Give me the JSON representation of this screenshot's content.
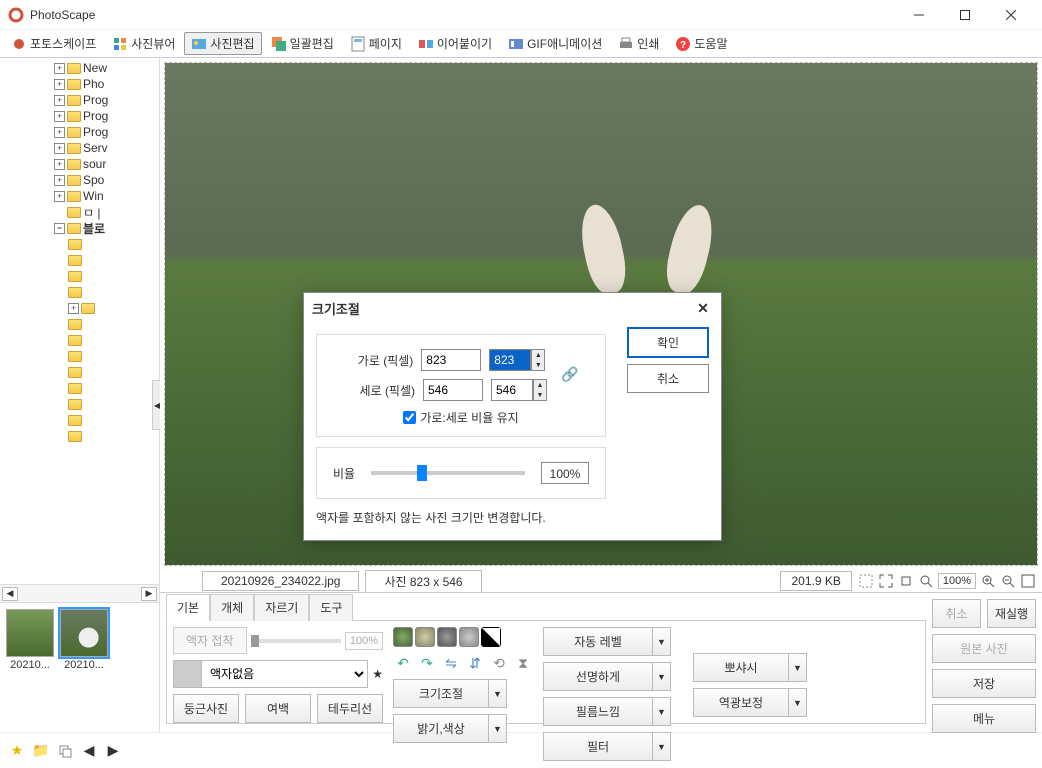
{
  "window": {
    "title": "PhotoScape"
  },
  "toolbar": {
    "tabs": [
      {
        "label": "포토스케이프"
      },
      {
        "label": "사진뷰어"
      },
      {
        "label": "사진편집"
      },
      {
        "label": "일괄편집"
      },
      {
        "label": "페이지"
      },
      {
        "label": "이어붙이기"
      },
      {
        "label": "GIF애니메이션"
      },
      {
        "label": "인쇄"
      },
      {
        "label": "도움말"
      }
    ],
    "active_index": 2
  },
  "tree": {
    "items": [
      {
        "label": "New",
        "exp": "+"
      },
      {
        "label": "Pho",
        "exp": "+"
      },
      {
        "label": "Prog",
        "exp": "+"
      },
      {
        "label": "Prog",
        "exp": "+"
      },
      {
        "label": "Prog",
        "exp": "+"
      },
      {
        "label": "Serv",
        "exp": "+"
      },
      {
        "label": "sour",
        "exp": "+"
      },
      {
        "label": "Spo",
        "exp": "+"
      },
      {
        "label": "Win",
        "exp": "+"
      },
      {
        "label": "ㅁ |",
        "exp": "+"
      },
      {
        "label": "블로",
        "exp": "-",
        "bold": true
      }
    ]
  },
  "thumbs": [
    {
      "caption": "20210..."
    },
    {
      "caption": "20210...",
      "selected": true
    }
  ],
  "status": {
    "filename": "20210926_234022.jpg",
    "dimensions": "사진 823 x 546",
    "filesize": "201.9 KB",
    "zoom": "100%"
  },
  "tabs2": {
    "items": [
      {
        "label": "기본"
      },
      {
        "label": "개체"
      },
      {
        "label": "자르기"
      },
      {
        "label": "도구"
      }
    ],
    "active_index": 0
  },
  "frame": {
    "btn_frame": "액자 접착",
    "pct": "100%",
    "select": "액자없음",
    "btn_round": "둥근사진",
    "btn_margin": "여백",
    "btn_border": "테두리선"
  },
  "combos": {
    "resize": "크기조절",
    "bright": "밝기,색상",
    "autolevel": "자동 레벨",
    "sharpen": "선명하게",
    "film": "필름느낌",
    "filter": "필터",
    "bloom": "뽀샤시",
    "backlight": "역광보정"
  },
  "right": {
    "undo": "취소",
    "redo": "재실행",
    "original": "원본 사진",
    "save": "저장",
    "menu": "메뉴"
  },
  "dialog": {
    "title": "크기조절",
    "width_label": "가로 (픽셀)",
    "height_label": "세로 (픽셀)",
    "width": "823",
    "width2": "823",
    "height": "546",
    "height2": "546",
    "keep_ratio": "가로:세로 비율 유지",
    "ratio_label": "비율",
    "ratio_pct": "100%",
    "note": "액자를 포함하지 않는 사진 크기만 변경합니다.",
    "ok": "확인",
    "cancel": "취소"
  }
}
